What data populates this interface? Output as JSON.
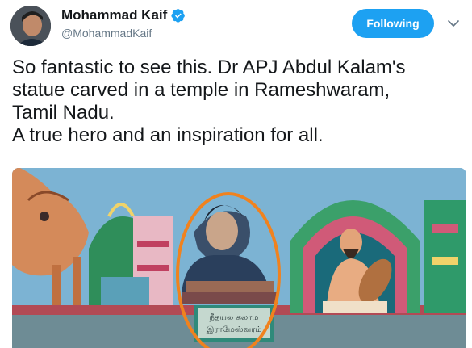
{
  "author": {
    "display_name": "Mohammad Kaif",
    "handle": "@MohammadKaif",
    "verified_icon": "verified-badge-icon",
    "avatar_icon": "avatar"
  },
  "follow_button": {
    "label": "Following"
  },
  "menu_icon": "chevron-down-icon",
  "tweet": {
    "text": "So fantastic to see this. Dr APJ Abdul Kalam's\nstatue carved in a temple in Rameshwaram,\nTamil Nadu.\nA true hero and an inspiration for all."
  },
  "media": {
    "plaque_line1": "நீதயல கலாம",
    "plaque_line2": "இராமேஸ்வரம்"
  },
  "colors": {
    "accent": "#1da1f2",
    "text": "#14171a",
    "secondary": "#657786",
    "highlight_circle": "#f0821e"
  }
}
